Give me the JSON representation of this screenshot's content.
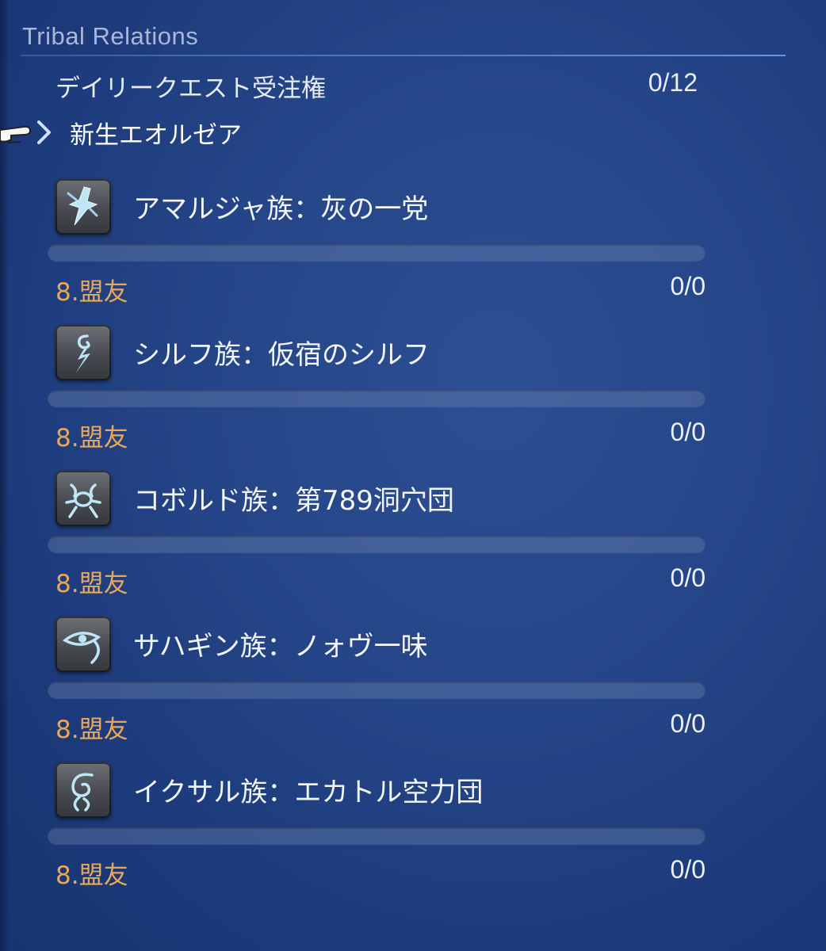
{
  "header": {
    "title": "Tribal Relations"
  },
  "daily_quests": {
    "label": "デイリークエスト受注権",
    "value": "0/12"
  },
  "section": {
    "label": "新生エオルゼア",
    "icon": "chevron-right-icon"
  },
  "tribes": [
    {
      "name": "アマルジャ族：灰の一党",
      "icon": "amaljaa-emblem-icon",
      "rank": "8.盟友",
      "reputation": "0/0",
      "progress": 0
    },
    {
      "name": "シルフ族：仮宿のシルフ",
      "icon": "sylph-emblem-icon",
      "rank": "8.盟友",
      "reputation": "0/0",
      "progress": 0
    },
    {
      "name": "コボルド族：第789洞穴団",
      "icon": "kobold-emblem-icon",
      "rank": "8.盟友",
      "reputation": "0/0",
      "progress": 0
    },
    {
      "name": "サハギン族：ノォヴ一味",
      "icon": "sahagin-emblem-icon",
      "rank": "8.盟友",
      "reputation": "0/0",
      "progress": 0
    },
    {
      "name": "イクサル族：エカトル空力団",
      "icon": "ixal-emblem-icon",
      "rank": "8.盟友",
      "reputation": "0/0",
      "progress": 0
    }
  ],
  "colors": {
    "rank": "#e8a85a",
    "background": "#244487",
    "rule": "#4d78c8"
  }
}
